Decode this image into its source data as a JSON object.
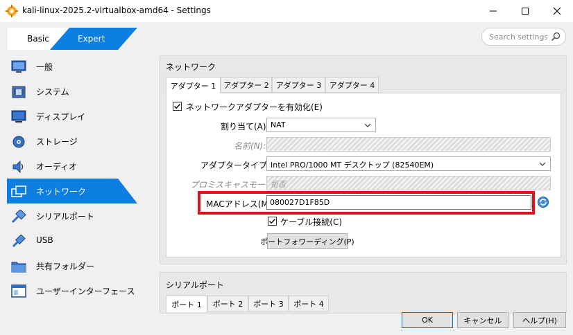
{
  "window": {
    "title": "kali-linux-2025.2-virtualbox-amd64 - Settings",
    "minimize": "—",
    "maximize": "☐",
    "close": "✕"
  },
  "mode": {
    "basic": "Basic",
    "expert": "Expert"
  },
  "search": {
    "placeholder": "Search settings"
  },
  "sidebar": {
    "items": [
      {
        "label": "一般",
        "icon": "monitor-general-icon"
      },
      {
        "label": "システム",
        "icon": "chip-system-icon"
      },
      {
        "label": "ディスプレイ",
        "icon": "display-icon"
      },
      {
        "label": "ストレージ",
        "icon": "storage-disk-icon"
      },
      {
        "label": "オーディオ",
        "icon": "speaker-audio-icon"
      },
      {
        "label": "ネットワーク",
        "icon": "network-icon",
        "selected": true
      },
      {
        "label": "シリアルポート",
        "icon": "serial-port-icon"
      },
      {
        "label": "USB",
        "icon": "usb-icon"
      },
      {
        "label": "共有フォルダー",
        "icon": "shared-folder-icon"
      },
      {
        "label": "ユーザーインターフェース",
        "icon": "user-interface-icon"
      }
    ]
  },
  "network": {
    "title": "ネットワーク",
    "tabs": [
      "アダプター 1",
      "アダプター 2",
      "アダプター 3",
      "アダプター 4"
    ],
    "active_tab": 0,
    "enable_adapter": {
      "label": "ネットワークアダプターを有効化(E)",
      "checked": true
    },
    "attached_to": {
      "label": "割り当て(A):",
      "value": "NAT"
    },
    "name": {
      "label": "名前(N):",
      "value": ""
    },
    "adapter_type": {
      "label": "アダプタータイプ(T):",
      "value": "Intel PRO/1000 MT デスクトップ (82540EM)"
    },
    "promiscuous": {
      "label": "プロミスキャスモード(P):",
      "value": "拒否"
    },
    "mac": {
      "label": "MACアドレス(M):",
      "value": "080027D1F85D"
    },
    "cable": {
      "label": "ケーブル接続(C)",
      "checked": true
    },
    "port_forwarding": {
      "label": "ポートフォワーディング(P)"
    }
  },
  "serial": {
    "title": "シリアルポート",
    "tabs": [
      "ポート 1",
      "ポート 2",
      "ポート 3",
      "ポート 4"
    ]
  },
  "footer": {
    "ok": "OK",
    "cancel": "キャンセル",
    "help": "ヘルプ(H)"
  },
  "colors": {
    "accent": "#0d7fe0",
    "highlight": "#e0101e"
  }
}
